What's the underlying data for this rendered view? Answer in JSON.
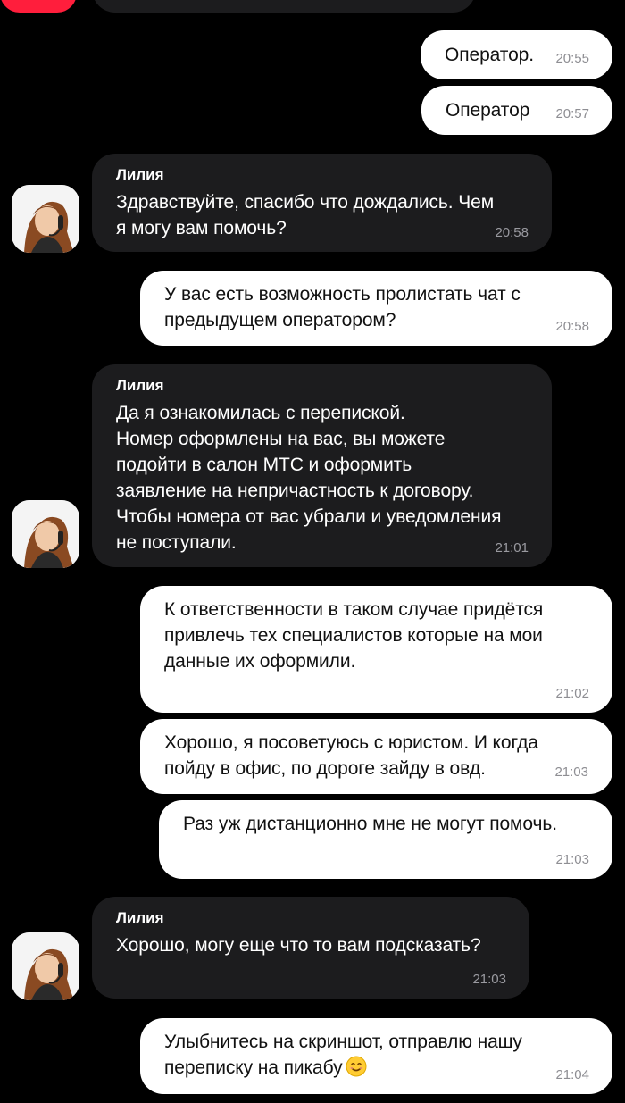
{
  "messages": [
    {
      "dir": "out",
      "text": "Оператор.",
      "time": "20:55"
    },
    {
      "dir": "out",
      "text": "Оператор",
      "time": "20:57"
    },
    {
      "dir": "in",
      "sender": "Лилия",
      "text": "Здравствуйте, спасибо что дождались. Чем\nя могу вам помочь?",
      "time": "20:58"
    },
    {
      "dir": "out",
      "text": "У вас есть возможность пролистать чат с\nпредыдущем оператором?",
      "time": "20:58"
    },
    {
      "dir": "in",
      "sender": "Лилия",
      "text": "Да я ознакомилась с перепиской.\nНомер оформлены на вас, вы можете\nподойти в салон МТС и оформить\nзаявление на непричастность к договору.\nЧтобы номера от вас убрали и уведомления\nне поступали.",
      "time": "21:01"
    },
    {
      "dir": "out",
      "text": "К ответственности в таком случае придётся\nпривлечь тех специалистов которые на мои\nданные их оформили.",
      "time": "21:02"
    },
    {
      "dir": "out",
      "text": "Хорошо, я посоветуюсь с юристом. И когда\nпойду в офис, по дороге зайду в овд.",
      "time": "21:03"
    },
    {
      "dir": "out",
      "text": "Раз уж дистанционно мне не могут помочь.",
      "time": "21:03"
    },
    {
      "dir": "in",
      "sender": "Лилия",
      "text": "Хорошо, могу еще что то вам подсказать?",
      "time": "21:03"
    },
    {
      "dir": "out",
      "text": "Улыбнитесь на скриншот, отправлю нашу\nпереписку на пикабу",
      "emoji": "smiling-face-emoji",
      "time": "21:04"
    }
  ],
  "avatar_icon": "operator-avatar-icon",
  "colors": {
    "background": "#000000",
    "outgoing_bubble": "#ffffff",
    "incoming_bubble": "#1c1c1e",
    "brand_red": "#ff1e3c",
    "timestamp": "#8e8e93"
  }
}
